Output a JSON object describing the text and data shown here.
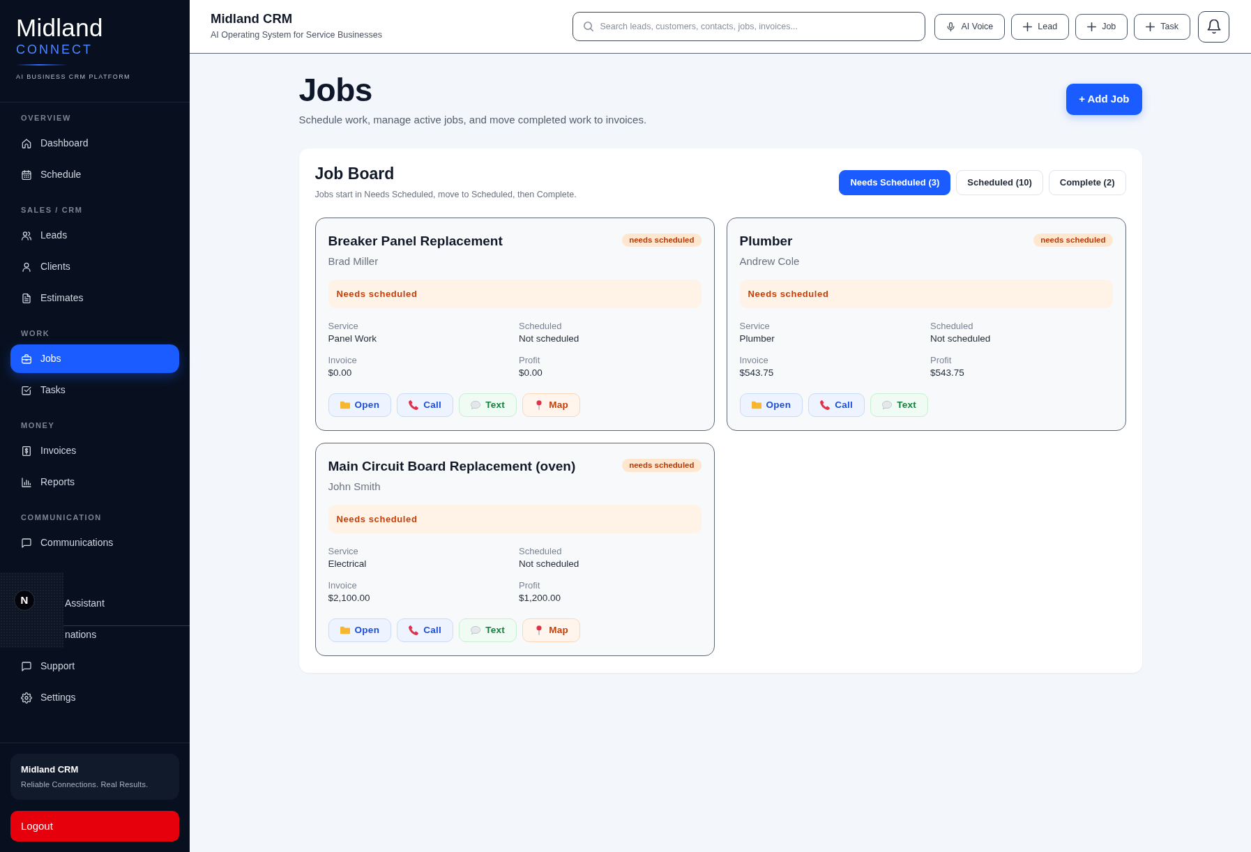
{
  "sidebar": {
    "brand": {
      "name": "Midland",
      "subname": "CONNECT",
      "tagline": "AI BUSINESS CRM PLATFORM"
    },
    "sections": [
      {
        "title": "OVERVIEW",
        "items": [
          {
            "label": "Dashboard",
            "kind": "link",
            "selected": false
          },
          {
            "label": "Schedule",
            "kind": "link",
            "selected": false
          }
        ]
      },
      {
        "title": "SALES / CRM",
        "items": [
          {
            "label": "Leads",
            "kind": "link",
            "selected": false
          },
          {
            "label": "Clients",
            "kind": "link",
            "selected": false
          },
          {
            "label": "Estimates",
            "kind": "link",
            "selected": false
          }
        ]
      },
      {
        "title": "WORK",
        "items": [
          {
            "label": "Jobs",
            "kind": "link",
            "selected": true
          },
          {
            "label": "Tasks",
            "kind": "link",
            "selected": false
          }
        ]
      },
      {
        "title": "MONEY",
        "items": [
          {
            "label": "Invoices",
            "kind": "link",
            "selected": false
          },
          {
            "label": "Reports",
            "kind": "link",
            "selected": false
          }
        ]
      },
      {
        "title": "COMMUNICATION",
        "items": [
          {
            "label": "Communications",
            "kind": "link",
            "selected": false
          }
        ]
      },
      {
        "items": [
          {
            "label": "Assistant",
            "kind": "partial",
            "selected": false
          },
          {
            "label": "nations",
            "kind": "partial",
            "selected": false
          },
          {
            "label": "Support",
            "kind": "link",
            "selected": false
          },
          {
            "label": "Settings",
            "kind": "link",
            "selected": false
          }
        ]
      }
    ],
    "footer_card": {
      "title": "Midland CRM",
      "text": "Reliable Connections. Real Results."
    },
    "logout_button": "Logout"
  },
  "dev_indicator": {
    "label": "N"
  },
  "topbar": {
    "title": "Midland CRM",
    "subtitle": "AI Operating System for Service Businesses",
    "search": {
      "placeholder": "Search leads, customers, contacts, jobs, invoices..."
    },
    "actions": [
      {
        "label": "AI Voice",
        "kind": "voice"
      },
      {
        "label": "Lead",
        "kind": "add"
      },
      {
        "label": "Job",
        "kind": "add"
      },
      {
        "label": "Task",
        "kind": "add"
      }
    ]
  },
  "page": {
    "title": "Jobs",
    "subtitle": "Schedule work, manage active jobs, and move completed work to invoices.",
    "add_button": "+ Add Job"
  },
  "board": {
    "title": "Job Board",
    "subtitle": "Jobs start in Needs Scheduled, move to Scheduled, then Complete.",
    "tabs": [
      {
        "label": "Needs Scheduled (3)",
        "selected": true
      },
      {
        "label": "Scheduled (10)",
        "selected": false
      },
      {
        "label": "Complete (2)",
        "selected": false
      }
    ],
    "jobs": [
      {
        "title": "Breaker Panel Replacement",
        "customer": "Brad Miller",
        "badge": "needs scheduled",
        "notice": "Needs scheduled",
        "fields": [
          {
            "label": "Service",
            "value": "Panel Work"
          },
          {
            "label": "Scheduled",
            "value": "Not scheduled"
          },
          {
            "label": "Invoice",
            "value": "$0.00"
          },
          {
            "label": "Profit",
            "value": "$0.00"
          }
        ],
        "actions": [
          {
            "label": "Open",
            "kind": "open"
          },
          {
            "label": "Call",
            "kind": "call"
          },
          {
            "label": "Text",
            "kind": "text"
          },
          {
            "label": "Map",
            "kind": "map"
          }
        ]
      },
      {
        "title": "Plumber",
        "customer": "Andrew Cole",
        "badge": "needs scheduled",
        "notice": "Needs scheduled",
        "fields": [
          {
            "label": "Service",
            "value": "Plumber"
          },
          {
            "label": "Scheduled",
            "value": "Not scheduled"
          },
          {
            "label": "Invoice",
            "value": "$543.75"
          },
          {
            "label": "Profit",
            "value": "$543.75"
          }
        ],
        "actions": [
          {
            "label": "Open",
            "kind": "open"
          },
          {
            "label": "Call",
            "kind": "call"
          },
          {
            "label": "Text",
            "kind": "text"
          }
        ]
      },
      {
        "title": "Main Circuit Board Replacement (oven)",
        "customer": "John Smith",
        "badge": "needs scheduled",
        "notice": "Needs scheduled",
        "fields": [
          {
            "label": "Service",
            "value": "Electrical"
          },
          {
            "label": "Scheduled",
            "value": "Not scheduled"
          },
          {
            "label": "Invoice",
            "value": "$2,100.00"
          },
          {
            "label": "Profit",
            "value": "$1,200.00"
          }
        ],
        "actions": [
          {
            "label": "Open",
            "kind": "open"
          },
          {
            "label": "Call",
            "kind": "call"
          },
          {
            "label": "Text",
            "kind": "text"
          },
          {
            "label": "Map",
            "kind": "map"
          }
        ]
      }
    ]
  }
}
